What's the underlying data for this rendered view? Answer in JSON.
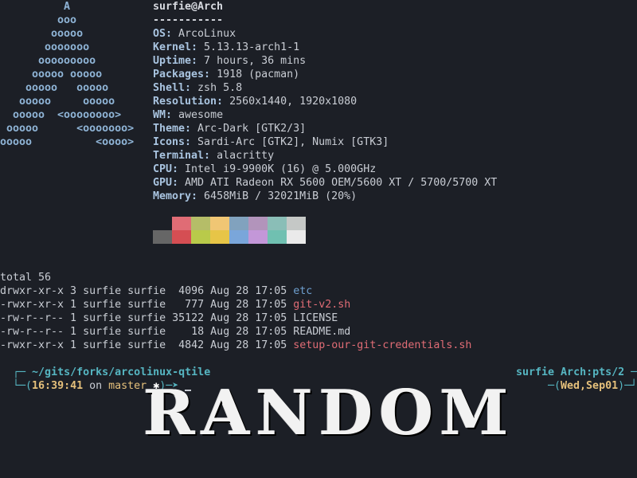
{
  "logo_lines": [
    "          A",
    "         ooo",
    "        ooooo",
    "       ooooooo",
    "      ooooooooo",
    "     ooooo ooooo",
    "    ooooo   ooooo",
    "   ooooo     ooooo",
    "  ooooo  <oooooooo>",
    " ooooo      <ooooooo>",
    "ooooo          <oooo>"
  ],
  "info": {
    "userhost": "surfie@Arch",
    "sep": "-----------",
    "rows": [
      {
        "k": "OS",
        "v": "ArcoLinux"
      },
      {
        "k": "Kernel",
        "v": "5.13.13-arch1-1"
      },
      {
        "k": "Uptime",
        "v": "7 hours, 36 mins"
      },
      {
        "k": "Packages",
        "v": "1918 (pacman)"
      },
      {
        "k": "Shell",
        "v": "zsh 5.8"
      },
      {
        "k": "Resolution",
        "v": "2560x1440, 1920x1080"
      },
      {
        "k": "WM",
        "v": "awesome"
      },
      {
        "k": "Theme",
        "v": "Arc-Dark [GTK2/3]"
      },
      {
        "k": "Icons",
        "v": "Sardi-Arc [GTK2], Numix [GTK3]"
      },
      {
        "k": "Terminal",
        "v": "alacritty"
      },
      {
        "k": "CPU",
        "v": "Intel i9-9900K (16) @ 5.000GHz"
      },
      {
        "k": "GPU",
        "v": "AMD ATI Radeon RX 5600 OEM/5600 XT / 5700/5700 XT"
      },
      {
        "k": "Memory",
        "v": "6458MiB / 32021MiB (20%)"
      }
    ]
  },
  "palette": {
    "top": [
      "#1c1f26",
      "#e06c75",
      "#b5bd68",
      "#f0c674",
      "#81a2be",
      "#b294bb",
      "#8abeb7",
      "#c5c8c6"
    ],
    "bottom": [
      "#666666",
      "#d54e53",
      "#b9ca4a",
      "#e7c547",
      "#7aa6da",
      "#c397d8",
      "#70c0b1",
      "#eaeaea"
    ]
  },
  "ls": {
    "total": "total 56",
    "rows": [
      {
        "meta": "drwxr-xr-x 3 surfie surfie  4096 Aug 28 17:05 ",
        "name": "etc",
        "color": "#6e9fcf"
      },
      {
        "meta": "-rwxr-xr-x 1 surfie surfie   777 Aug 28 17:05 ",
        "name": "git-v2.sh",
        "color": "#e06c75"
      },
      {
        "meta": "-rw-r--r-- 1 surfie surfie 35122 Aug 28 17:05 ",
        "name": "LICENSE",
        "color": "#c9cdd4"
      },
      {
        "meta": "-rw-r--r-- 1 surfie surfie    18 Aug 28 17:05 ",
        "name": "README.md",
        "color": "#c9cdd4"
      },
      {
        "meta": "-rwxr-xr-x 1 surfie surfie  4842 Aug 28 17:05 ",
        "name": "setup-our-git-credentials.sh",
        "color": "#e06c75"
      }
    ]
  },
  "prompt": {
    "line1_left_deco": "┌─ ",
    "path": "~/gits/forks/arcolinux-qtile",
    "line1_fill": " ─────────────────────────────────────────────── ",
    "user_tty": "surfie Arch:pts/2",
    "line1_right_deco": " ─┐",
    "line2_left_deco": "└─(",
    "time": "16:39:41",
    "on": " on ",
    "branch": "master",
    "dirty": " ✱",
    "arrow": ")─➤ ",
    "line2_right_deco": "─(",
    "date": "Wed,Sep01",
    "line2_right_end": ")─┘"
  },
  "banner_text": "RANDOM"
}
